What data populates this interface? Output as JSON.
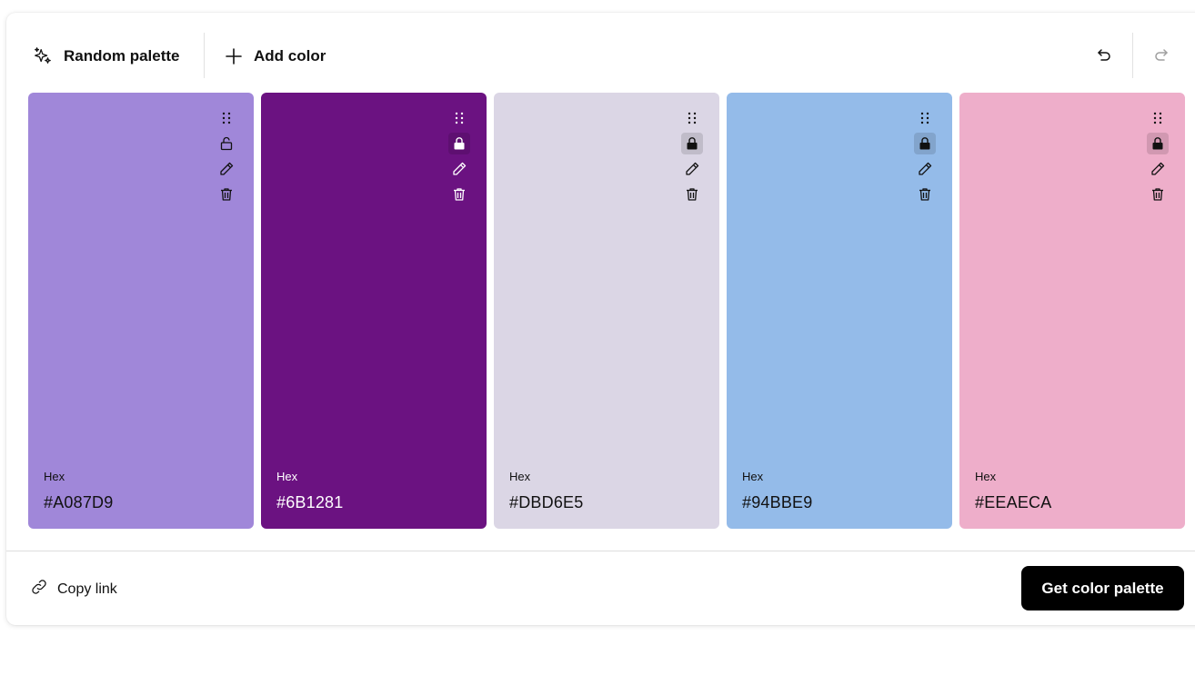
{
  "toolbar": {
    "random_label": "Random palette",
    "add_label": "Add color",
    "undo_icon": "undo-icon",
    "redo_icon": "redo-icon"
  },
  "palette": {
    "hex_label": "Hex",
    "colors": [
      {
        "hex": "#A087D9",
        "text_color": "#111111",
        "locked": false
      },
      {
        "hex": "#6B1281",
        "text_color": "#ffffff",
        "locked": true
      },
      {
        "hex": "#DBD6E5",
        "text_color": "#111111",
        "locked": true
      },
      {
        "hex": "#94BBE9",
        "text_color": "#111111",
        "locked": true
      },
      {
        "hex": "#EEAECA",
        "text_color": "#111111",
        "locked": true
      }
    ]
  },
  "footer": {
    "copy_label": "Copy link",
    "get_label": "Get color palette"
  }
}
